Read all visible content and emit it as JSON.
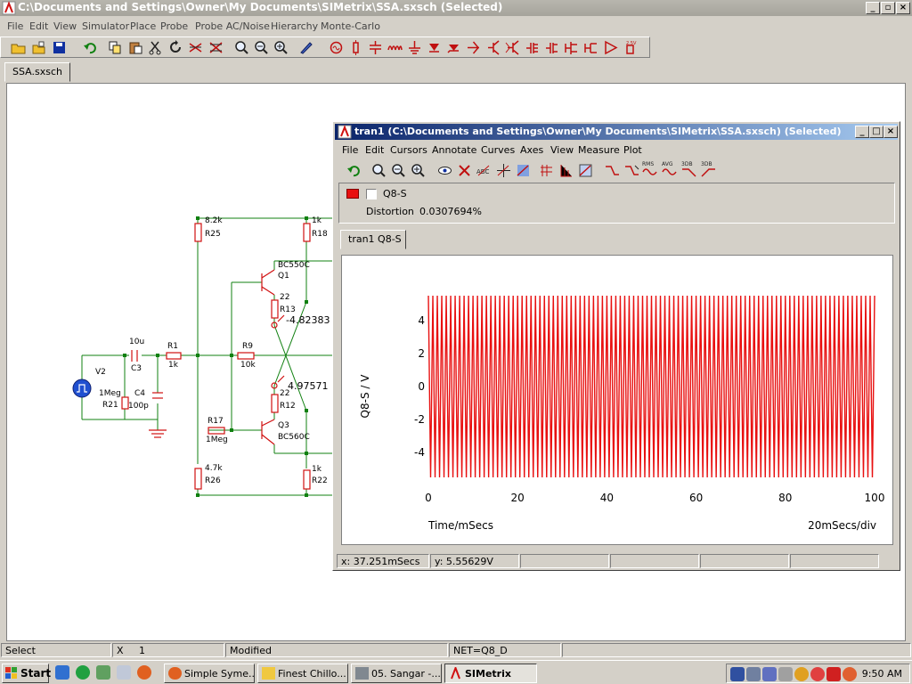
{
  "main_window": {
    "title": "C:\\Documents and Settings\\Owner\\My Documents\\SIMetrix\\SSA.sxsch (Selected)",
    "menu": [
      "File",
      "Edit",
      "View",
      "Simulator",
      "Place",
      "Probe",
      "Probe AC/Noise",
      "Hierarchy",
      "Monte-Carlo"
    ],
    "document_tab": "SSA.sxsch"
  },
  "schematic": {
    "labels": {
      "r25_val": "8.2k",
      "r25": "R25",
      "r18_val": "1k",
      "r18": "R18",
      "q1_type": "BC550C",
      "q1": "Q1",
      "r13_val": "22",
      "r13": "R13",
      "probe_neg": "-4.82383",
      "c3_val": "10u",
      "c3": "C3",
      "r1": "R1",
      "r1_val": "1k",
      "r9": "R9",
      "r9_val": "10k",
      "probe_pos": "4.97571",
      "r12_val": "22",
      "r12": "R12",
      "v2": "V2",
      "r21_val": "1Meg",
      "r21": "R21",
      "c4": "C4",
      "c4_val": "100p",
      "r17": "R17",
      "r17_val": "1Meg",
      "q3": "Q3",
      "q3_type": "BC560C",
      "r26_val": "4.7k",
      "r26": "R26",
      "r22_val": "1k",
      "r22": "R22"
    }
  },
  "graph_window": {
    "title": "tran1 (C:\\Documents and Settings\\Owner\\My Documents\\SIMetrix\\SSA.sxsch) (Selected)",
    "menu": [
      "File",
      "Edit",
      "Cursors",
      "Annotate",
      "Curves",
      "Axes",
      "View",
      "Measure",
      "Plot"
    ],
    "toolbar_labels": [
      "RMS",
      "AVG",
      "3DB",
      "3DB"
    ],
    "legend": {
      "series_name": "Q8-S",
      "color": "#e81010",
      "distortion_label": "Distortion",
      "distortion_value": "0.0307694%"
    },
    "graph_tab": "tran1 Q8-S",
    "status": {
      "x": "x: 37.251mSecs",
      "y": "y: 5.55629V"
    }
  },
  "chart_data": {
    "type": "line",
    "series": [
      {
        "name": "Q8-S",
        "color": "#e81010"
      }
    ],
    "description_signal": {
      "carrier_cycles": 100,
      "amplitude_v": 5.5
    },
    "xlabel": "Time/mSecs",
    "ylabel": "Q8-S / V",
    "x_scale_note": "20mSecs/div",
    "xlim": [
      0,
      100
    ],
    "ylim": [
      -6.2,
      6.2
    ],
    "x_ticks": [
      0,
      20,
      40,
      60,
      80,
      100
    ],
    "y_ticks": [
      4,
      2,
      0,
      -2,
      -4
    ],
    "y_tick_labels": [
      "4",
      "2",
      "0",
      "-2",
      "-4"
    ]
  },
  "main_status": {
    "mode": "Select",
    "x_label": "X",
    "x_value": "1",
    "modified": "Modified",
    "net": "NET=Q8_D"
  },
  "taskbar": {
    "start": "Start",
    "tasks": [
      "Simple Syme...",
      "Finest Chillo...",
      "05. Sangar -...",
      "SIMetrix"
    ],
    "clock": "9:50 AM"
  }
}
